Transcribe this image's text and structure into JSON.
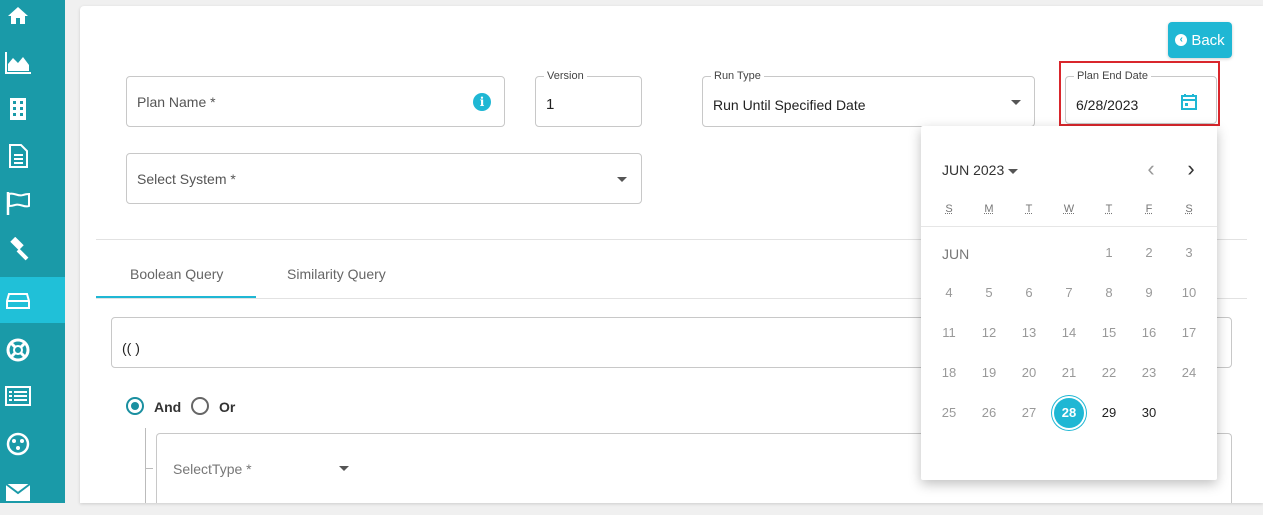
{
  "sidebar": {
    "items": [
      {
        "icon": "home-icon",
        "active": false
      },
      {
        "icon": "area-chart-icon",
        "active": false
      },
      {
        "icon": "building-icon",
        "active": false
      },
      {
        "icon": "document-icon",
        "active": false
      },
      {
        "icon": "flag-icon",
        "active": false
      },
      {
        "icon": "gavel-icon",
        "active": false
      },
      {
        "icon": "hard-drive-icon",
        "active": true
      },
      {
        "icon": "lifebuoy-icon",
        "active": false
      },
      {
        "icon": "list-icon",
        "active": false
      },
      {
        "icon": "palette-icon",
        "active": false
      },
      {
        "icon": "mail-icon",
        "active": false
      }
    ],
    "color": "#1a9aa8",
    "active_color": "#20c0d8"
  },
  "header": {
    "back_label": "Back"
  },
  "form": {
    "plan_name": {
      "placeholder": "Plan Name *"
    },
    "version": {
      "label": "Version",
      "value": "1"
    },
    "run_type": {
      "label": "Run Type",
      "value": "Run Until Specified Date"
    },
    "plan_end_date": {
      "label": "Plan End Date",
      "value": "6/28/2023"
    },
    "system": {
      "placeholder": "Select System *"
    }
  },
  "tabs": [
    {
      "label": "Boolean Query",
      "active": true
    },
    {
      "label": "Similarity Query",
      "active": false
    }
  ],
  "query": {
    "text": "(( )"
  },
  "logic": {
    "and_label": "And",
    "or_label": "Or",
    "selected": "And"
  },
  "condition": {
    "select_type_placeholder": "SelectType *"
  },
  "calendar": {
    "month_year": "JUN 2023",
    "month_label": "JUN",
    "weekdays": [
      "S",
      "M",
      "T",
      "W",
      "T",
      "F",
      "S"
    ],
    "weeks": [
      [
        null,
        null,
        null,
        null,
        "1",
        "2",
        "3"
      ],
      [
        "4",
        "5",
        "6",
        "7",
        "8",
        "9",
        "10"
      ],
      [
        "11",
        "12",
        "13",
        "14",
        "15",
        "16",
        "17"
      ],
      [
        "18",
        "19",
        "20",
        "21",
        "22",
        "23",
        "24"
      ],
      [
        "25",
        "26",
        "27",
        "28",
        "29",
        "30",
        null
      ]
    ],
    "selected_day": "28",
    "enabled_days": [
      "29",
      "30"
    ],
    "accent": "#1fb7d4"
  },
  "colors": {
    "accent": "#1fb7d4",
    "highlight": "#d9262c"
  }
}
